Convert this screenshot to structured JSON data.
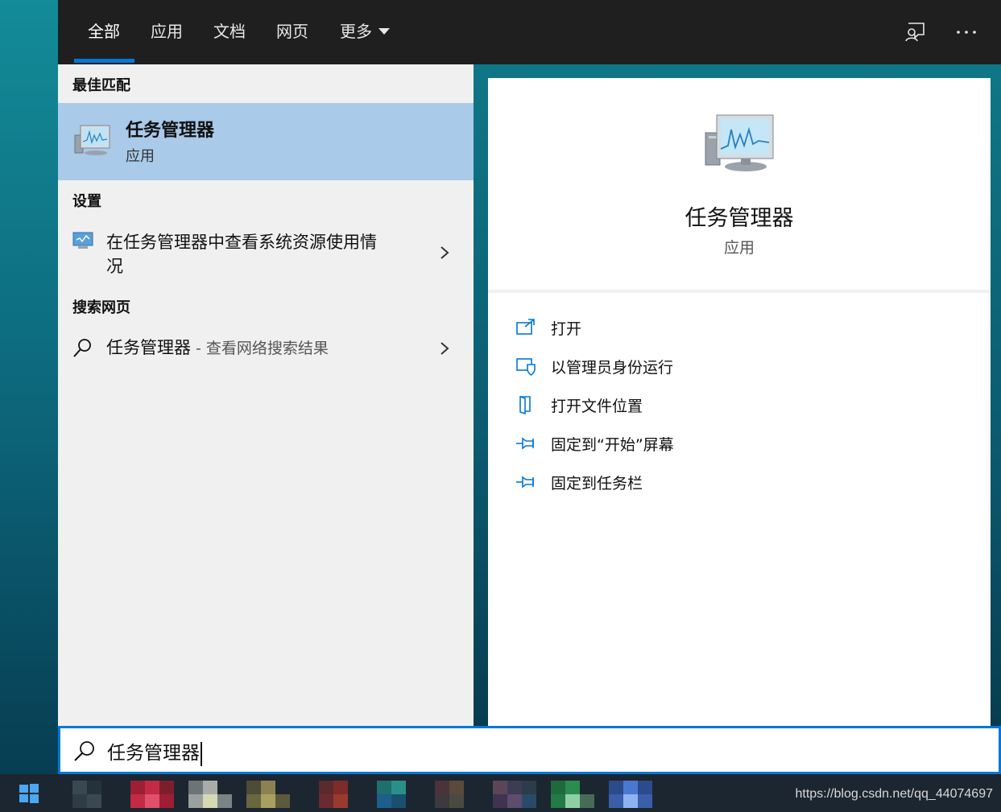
{
  "tabs": [
    {
      "label": "全部"
    },
    {
      "label": "应用"
    },
    {
      "label": "文档"
    },
    {
      "label": "网页"
    },
    {
      "label": "更多"
    }
  ],
  "left": {
    "best_match_heading": "最佳匹配",
    "best_match": {
      "title": "任务管理器",
      "subtitle": "应用"
    },
    "settings_heading": "设置",
    "settings_item": {
      "line1": "在任务管理器中查看系统资源使用情",
      "line2": "况"
    },
    "web_heading": "搜索网页",
    "web_item": {
      "query": "任务管理器",
      "suffix": " - 查看网络搜索结果"
    }
  },
  "preview": {
    "title": "任务管理器",
    "subtitle": "应用"
  },
  "actions": [
    {
      "label": "打开",
      "icon": "open-icon"
    },
    {
      "label": "以管理员身份运行",
      "icon": "shield-admin-icon"
    },
    {
      "label": "打开文件位置",
      "icon": "file-location-icon"
    },
    {
      "label": "固定到“开始”屏幕",
      "icon": "pin-icon"
    },
    {
      "label": "固定到任务栏",
      "icon": "pin-icon"
    }
  ],
  "search": {
    "value": "任务管理器"
  },
  "taskbar": {
    "watermark": "https://blog.csdn.net/qq_44074697"
  },
  "colors": {
    "accent": "#0078d7",
    "highlight": "#a9cae8",
    "topbar": "#1f1f1f",
    "panel": "#f0f0f0"
  }
}
